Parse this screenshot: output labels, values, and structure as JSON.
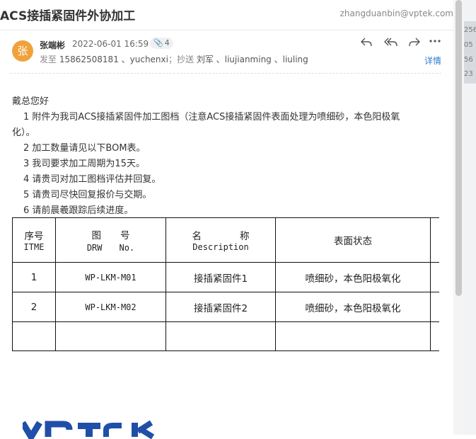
{
  "email": {
    "subject": "ACS接插紧固件外协加工",
    "owner_email": "zhangduanbin@vptek.com",
    "avatar_char": "张",
    "sender": "张端彬",
    "time": "2022-06-01 16:59",
    "attachment_count": "4",
    "to_label": "发至",
    "to": "15862508181 、yuchenxi",
    "cc_label": "；抄送",
    "cc": "刘军 、liujianming 、liuling",
    "detail_label": "详情",
    "actions": [
      "reply-icon",
      "reply-all-icon",
      "forward-icon",
      "more-icon"
    ]
  },
  "body": {
    "greeting": "戴总您好",
    "lines": [
      "1 附件为我司ACS接插紧固件加工图档（注意ACS接插紧固件表面处理为喷细砂，本色阳极氧",
      "化）。",
      "2 加工数量请见以下BOM表。",
      "3 我司要求加工周期为15天。",
      "4 请贵司对加工图档评估并回复。",
      "5 请贵司尽快回复报价与交期。",
      "6 请前晨羲跟踪后续进度。"
    ]
  },
  "bom": {
    "headers": [
      {
        "cn": "序号",
        "en": "ITME"
      },
      {
        "cn": "图　　号",
        "en": "DRW　　No."
      },
      {
        "cn": "名　　　　称",
        "en": "Description"
      },
      {
        "cn": "表面状态",
        "en": ""
      }
    ],
    "rows": [
      [
        "1",
        "WP-LKM-M01",
        "接插紧固件1",
        "喷细砂，本色阳极氧化"
      ],
      [
        "2",
        "WP-LKM-M02",
        "接插紧固件2",
        "喷细砂，本色阳极氧化"
      ],
      [
        "",
        "",
        "",
        ""
      ]
    ]
  },
  "side_strip": {
    "numbers": [
      "256",
      "05",
      "56",
      "23"
    ]
  },
  "logo": {
    "text": "VPTeK",
    "color": "#1f4fa8"
  }
}
